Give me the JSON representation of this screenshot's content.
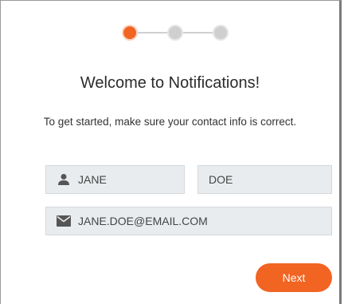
{
  "stepper": {
    "steps": [
      {
        "state": "active",
        "icon": "step-dot-active"
      },
      {
        "state": "inactive",
        "icon": "step-dot-inactive"
      },
      {
        "state": "inactive",
        "icon": "step-dot-inactive"
      }
    ],
    "current_step": 1,
    "total_steps": 3
  },
  "header": {
    "title": "Welcome to Notifications!",
    "subtitle": "To get started, make sure your contact info is correct."
  },
  "form": {
    "first_name": {
      "value": "JANE",
      "icon": "person-icon"
    },
    "last_name": {
      "value": "DOE"
    },
    "email": {
      "value": "JANE.DOE@EMAIL.COM",
      "icon": "envelope-icon"
    }
  },
  "actions": {
    "next_label": "Next"
  },
  "colors": {
    "accent": "#f26422",
    "field_bg": "#e9ecef",
    "inactive_dot": "#cfcfcf"
  }
}
